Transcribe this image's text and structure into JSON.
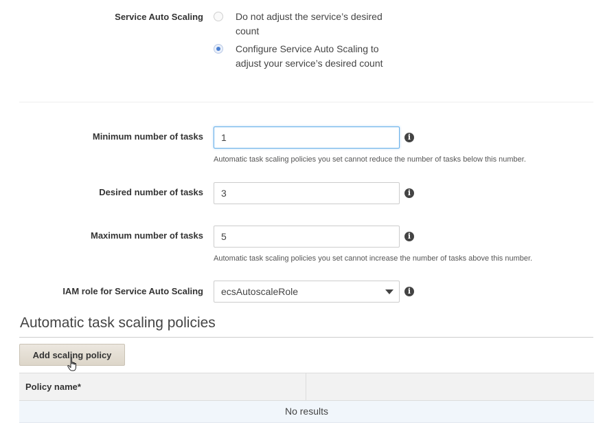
{
  "service_auto_scaling": {
    "label": "Service Auto Scaling",
    "options": [
      {
        "label": "Do not adjust the service’s desired count",
        "selected": false
      },
      {
        "label": "Configure Service Auto Scaling to adjust your service’s desired count",
        "selected": true
      }
    ]
  },
  "min_tasks": {
    "label": "Minimum number of tasks",
    "value": "1",
    "help": "Automatic task scaling policies you set cannot reduce the number of tasks below this number."
  },
  "desired_tasks": {
    "label": "Desired number of tasks",
    "value": "3"
  },
  "max_tasks": {
    "label": "Maximum number of tasks",
    "value": "5",
    "help": "Automatic task scaling policies you set cannot increase the number of tasks above this number."
  },
  "iam_role": {
    "label": "IAM role for Service Auto Scaling",
    "selected": "ecsAutoscaleRole"
  },
  "policies_section": {
    "title": "Automatic task scaling policies",
    "add_button": "Add scaling policy",
    "table": {
      "columns": [
        "Policy name*",
        ""
      ],
      "empty_text": "No results"
    }
  },
  "icons": {
    "info": "info-icon",
    "cursor": "hand-pointer-icon",
    "dropdown": "chevron-down-icon"
  },
  "colors": {
    "radio_selected": "#4a7fd1",
    "focus_border": "#66afe9",
    "button_bg": "#e5dfd4",
    "table_header_bg": "#f2f2f2",
    "empty_row_bg": "#f1f6fb"
  }
}
